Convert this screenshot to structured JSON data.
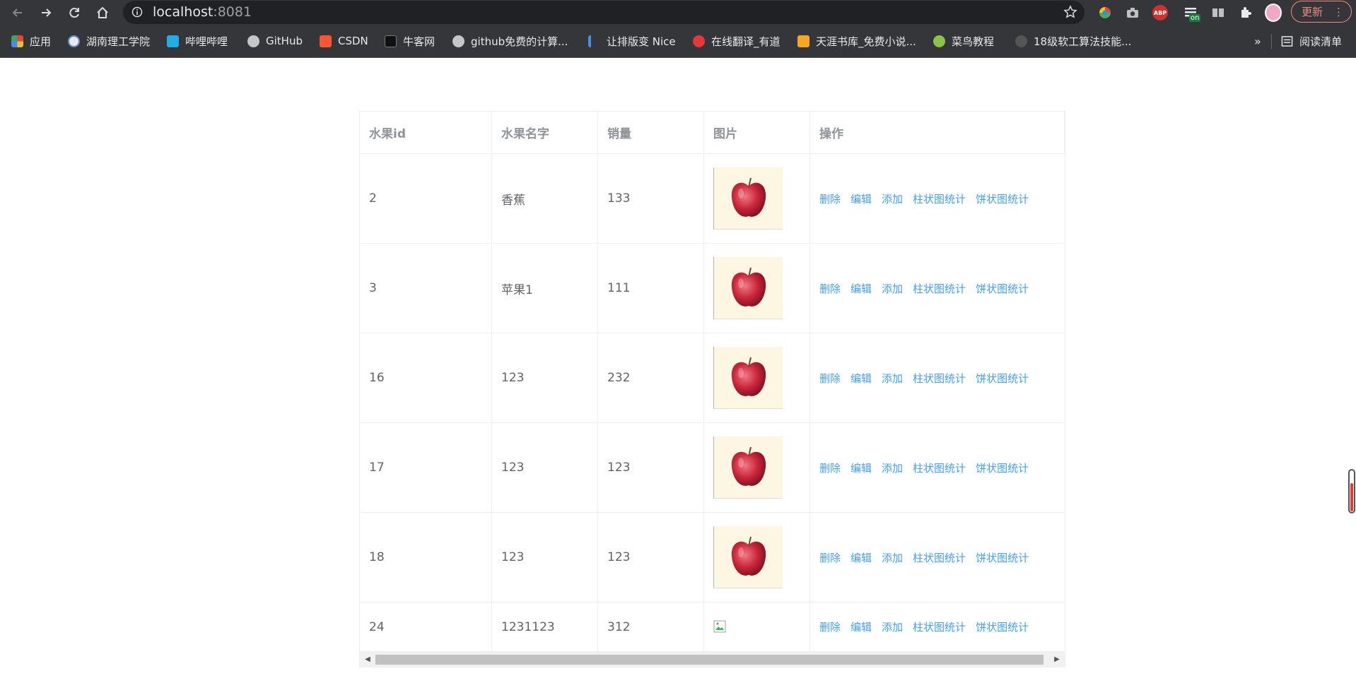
{
  "browser": {
    "url_host": "localhost",
    "url_port": ":8081",
    "update_label": "更新",
    "update_menu": "⋮",
    "ext_badge": "on",
    "abp_label": "ABP",
    "bookmarks": [
      {
        "label": "应用",
        "icon": "apps-grid-icon",
        "color": "#e8453c"
      },
      {
        "label": "湖南理工学院",
        "icon": "school-icon",
        "color": "#8ab4f8"
      },
      {
        "label": "哔哩哔哩",
        "icon": "bilibili-icon",
        "color": "#23ade5"
      },
      {
        "label": "GitHub",
        "icon": "github-icon",
        "color": "#c4c7c5"
      },
      {
        "label": "CSDN",
        "icon": "csdn-icon",
        "color": "#fc5531"
      },
      {
        "label": "牛客网",
        "icon": "nowcoder-icon",
        "color": "#111111"
      },
      {
        "label": "github免费的计算...",
        "icon": "github-icon",
        "color": "#c4c7c5"
      },
      {
        "label": "让排版变 Nice",
        "icon": "nice-icon",
        "color": "#4a90e2"
      },
      {
        "label": "在线翻译_有道",
        "icon": "youdao-icon",
        "color": "#e53935"
      },
      {
        "label": "天涯书库_免费小说...",
        "icon": "tianya-icon",
        "color": "#f5a623"
      },
      {
        "label": "菜鸟教程",
        "icon": "runoob-icon",
        "color": "#8bc34a"
      },
      {
        "label": "18级软工算法技能...",
        "icon": "c-icon",
        "color": "#555555"
      }
    ],
    "more_label": "»",
    "reading_list_label": "阅读清单"
  },
  "table": {
    "headers": [
      "水果id",
      "水果名字",
      "销量",
      "图片",
      "操作"
    ],
    "rows": [
      {
        "id": "2",
        "name": "香蕉",
        "sales": "133",
        "image": "apple"
      },
      {
        "id": "3",
        "name": "苹果1",
        "sales": "111",
        "image": "apple"
      },
      {
        "id": "16",
        "name": "123",
        "sales": "232",
        "image": "apple"
      },
      {
        "id": "17",
        "name": "123",
        "sales": "123",
        "image": "apple"
      },
      {
        "id": "18",
        "name": "123",
        "sales": "123",
        "image": "apple"
      },
      {
        "id": "24",
        "name": "1231123",
        "sales": "312",
        "image": "broken"
      }
    ],
    "actions": [
      "删除",
      "编辑",
      "添加",
      "柱状图统计",
      "饼状图统计"
    ]
  },
  "colors": {
    "link": "#409eff",
    "header_text": "#909399",
    "cell_text": "#606266",
    "border": "#ebeef5"
  }
}
